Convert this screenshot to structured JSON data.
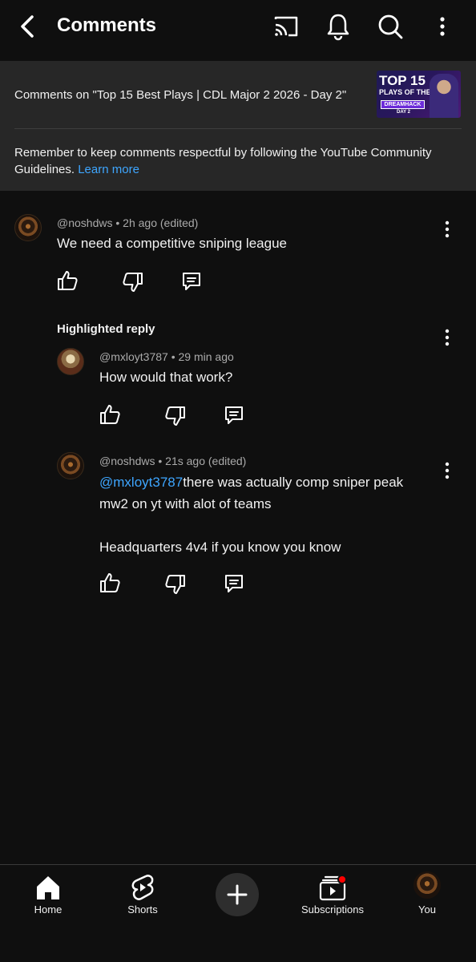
{
  "header": {
    "title": "Comments",
    "icons": [
      "back-arrow-icon",
      "cast-icon",
      "bell-icon",
      "search-icon",
      "more-vert-icon"
    ]
  },
  "video": {
    "comments_on": "Comments on \"Top 15 Best Plays | CDL Major 2 2026 - Day 2\"",
    "thumb_title": "TOP 15",
    "thumb_sub": "PLAYS OF THE",
    "thumb_brand": "DREAMHACK",
    "thumb_day": "DAY 2",
    "guidelines_text": "Remember to keep comments respectful by following the YouTube Community Guidelines.",
    "learn_more": "Learn more"
  },
  "comments": [
    {
      "author": "@noshdws",
      "time": "2h ago (edited)",
      "text": "We need a competitive sniping league"
    }
  ],
  "highlighted_label": "Highlighted reply",
  "replies": [
    {
      "author": "@mxloyt3787",
      "time": "29 min ago",
      "text": "How would that work?"
    },
    {
      "author": "@noshdws",
      "time": "21s ago (edited)",
      "mention": "@mxloyt3787",
      "text_line1": "there was actually comp sniper peak",
      "text_line2": "mw2 on yt with alot of teams",
      "text_line3": "Headquarters 4v4 if you know you know"
    }
  ],
  "nav": {
    "home": "Home",
    "shorts": "Shorts",
    "subscriptions": "Subscriptions",
    "you": "You"
  },
  "colors": {
    "background": "#0f0f0f",
    "strip": "#272727",
    "link": "#3ea6ff",
    "notification_dot": "#ff0000"
  }
}
